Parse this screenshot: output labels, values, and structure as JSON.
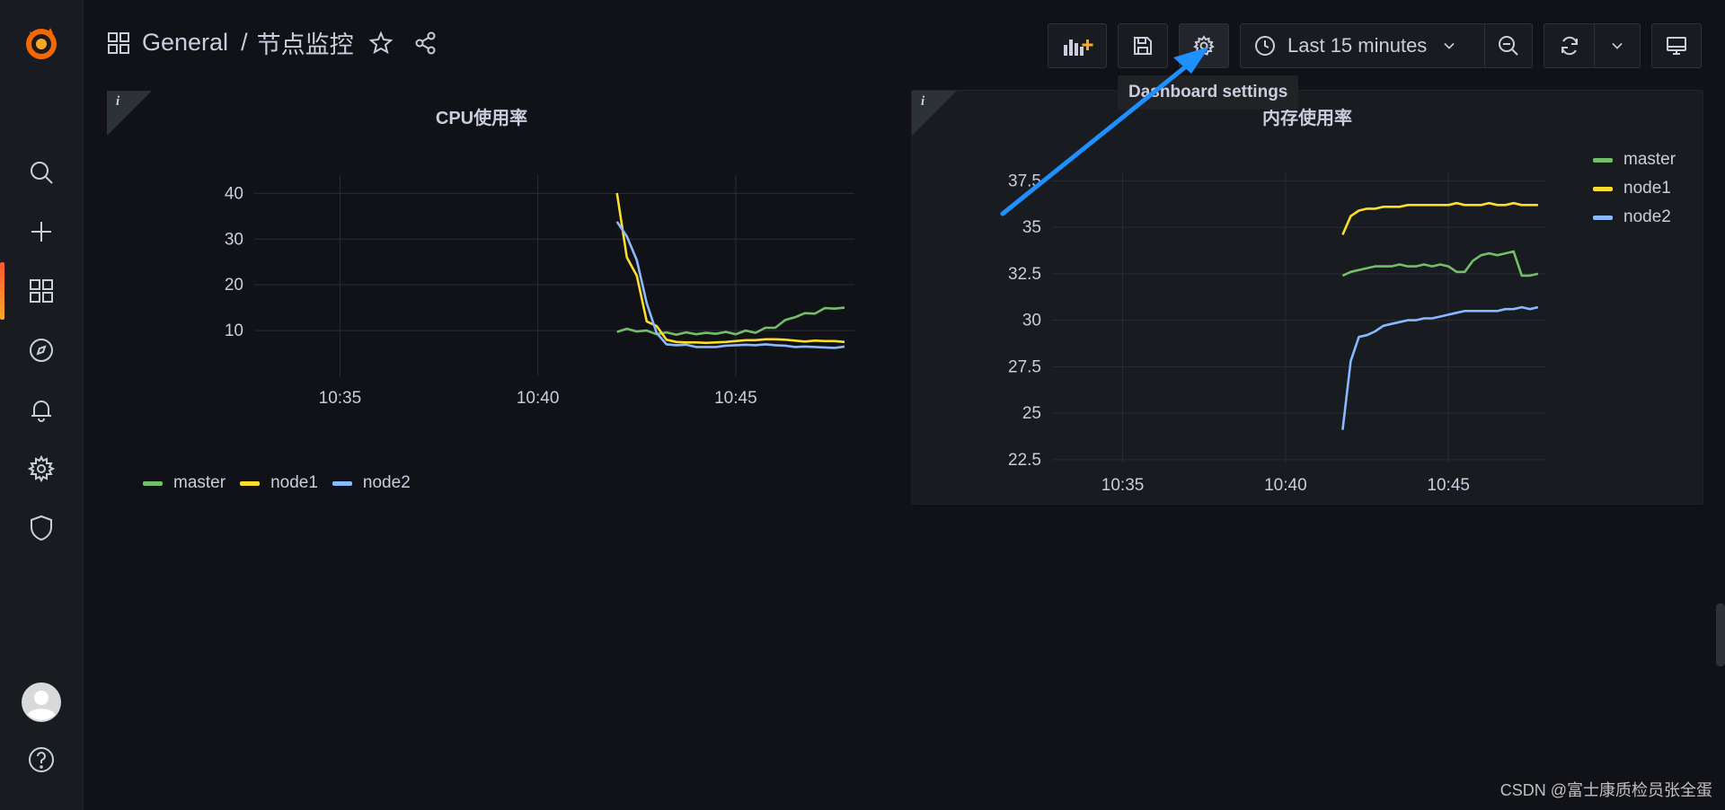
{
  "sidebar": {
    "items": [
      {
        "name": "search-icon"
      },
      {
        "name": "plus-icon"
      },
      {
        "name": "dashboards-icon"
      },
      {
        "name": "explore-compass-icon"
      },
      {
        "name": "alerting-bell-icon"
      },
      {
        "name": "gear-icon"
      },
      {
        "name": "shield-icon"
      }
    ],
    "bottom": [
      {
        "name": "avatar"
      },
      {
        "name": "help-icon"
      }
    ],
    "accent": "#ff5833"
  },
  "header": {
    "folder": "General",
    "separator": "/",
    "title": "节点监控"
  },
  "toolbar": {
    "time_range": "Last 15 minutes",
    "tooltip": "Dashboard settings"
  },
  "panels": [
    {
      "title": "CPU使用率",
      "info": "i",
      "legend_position": "bottom",
      "chart_data": {
        "type": "line",
        "title": "CPU使用率",
        "x_ticks": [
          "10:35",
          "10:40",
          "10:45"
        ],
        "y_ticks": [
          "10",
          "20",
          "30",
          "40"
        ],
        "xlim": [
          "10:32:50",
          "10:48:00"
        ],
        "ylim": [
          0,
          44
        ],
        "x": [
          "10:42:00",
          "10:42:15",
          "10:42:30",
          "10:42:45",
          "10:43:00",
          "10:43:15",
          "10:43:30",
          "10:43:45",
          "10:44:00",
          "10:44:15",
          "10:44:30",
          "10:44:45",
          "10:45:00",
          "10:45:15",
          "10:45:30",
          "10:45:45",
          "10:46:00",
          "10:46:15",
          "10:46:30",
          "10:46:45",
          "10:47:00",
          "10:47:15",
          "10:47:30",
          "10:47:45"
        ],
        "series": [
          {
            "name": "master",
            "color": "#73bf69",
            "values": [
              9.7,
              10.4,
              9.8,
              10.0,
              9.2,
              9.6,
              9.1,
              9.6,
              9.2,
              9.5,
              9.3,
              9.7,
              9.2,
              10.0,
              9.5,
              10.6,
              10.6,
              12.3,
              12.9,
              13.8,
              13.7,
              14.9,
              14.8,
              15.0
            ]
          },
          {
            "name": "node1",
            "color": "#fade2a",
            "values": [
              40.1,
              26.0,
              22.0,
              12.0,
              11.0,
              8.0,
              7.5,
              7.4,
              7.4,
              7.3,
              7.4,
              7.5,
              7.7,
              7.9,
              7.9,
              8.1,
              8.1,
              8.0,
              7.8,
              7.6,
              7.8,
              7.7,
              7.7,
              7.5
            ]
          },
          {
            "name": "node2",
            "color": "#8ab8ff",
            "values": [
              33.8,
              30.6,
              25.4,
              16.0,
              9.5,
              7.0,
              6.8,
              6.9,
              6.4,
              6.4,
              6.4,
              6.7,
              6.8,
              6.9,
              6.8,
              7.0,
              6.8,
              6.7,
              6.4,
              6.5,
              6.4,
              6.3,
              6.2,
              6.5
            ]
          }
        ]
      }
    },
    {
      "title": "内存使用率",
      "info": "i",
      "legend_position": "right",
      "chart_data": {
        "type": "line",
        "title": "内存使用率",
        "x_ticks": [
          "10:35",
          "10:40",
          "10:45"
        ],
        "y_ticks": [
          "22.5",
          "25",
          "27.5",
          "30",
          "32.5",
          "35",
          "37.5"
        ],
        "xlim": [
          "10:32:50",
          "10:48:00"
        ],
        "ylim": [
          22.3,
          38.0
        ],
        "x": [
          "10:41:45",
          "10:42:00",
          "10:42:15",
          "10:42:30",
          "10:42:45",
          "10:43:00",
          "10:43:15",
          "10:43:30",
          "10:43:45",
          "10:44:00",
          "10:44:15",
          "10:44:30",
          "10:44:45",
          "10:45:00",
          "10:45:15",
          "10:45:30",
          "10:45:45",
          "10:46:00",
          "10:46:15",
          "10:46:30",
          "10:46:45",
          "10:47:00",
          "10:47:15",
          "10:47:30",
          "10:47:45"
        ],
        "series": [
          {
            "name": "master",
            "color": "#73bf69",
            "values": [
              32.4,
              32.6,
              32.7,
              32.8,
              32.9,
              32.9,
              32.9,
              33.0,
              32.9,
              32.9,
              33.0,
              32.9,
              33.0,
              32.9,
              32.6,
              32.6,
              33.2,
              33.5,
              33.6,
              33.5,
              33.6,
              33.7,
              32.4,
              32.4,
              32.5
            ]
          },
          {
            "name": "node1",
            "color": "#fade2a",
            "values": [
              34.6,
              35.6,
              35.9,
              36.0,
              36.0,
              36.1,
              36.1,
              36.1,
              36.2,
              36.2,
              36.2,
              36.2,
              36.2,
              36.2,
              36.3,
              36.2,
              36.2,
              36.2,
              36.3,
              36.2,
              36.2,
              36.3,
              36.2,
              36.2,
              36.2
            ]
          },
          {
            "name": "node2",
            "color": "#8ab8ff",
            "values": [
              24.1,
              27.8,
              29.1,
              29.2,
              29.4,
              29.7,
              29.8,
              29.9,
              30.0,
              30.0,
              30.1,
              30.1,
              30.2,
              30.3,
              30.4,
              30.5,
              30.5,
              30.5,
              30.5,
              30.5,
              30.6,
              30.6,
              30.7,
              30.6,
              30.7
            ]
          }
        ]
      }
    }
  ],
  "watermark": "CSDN @富士康质检员张全蛋"
}
